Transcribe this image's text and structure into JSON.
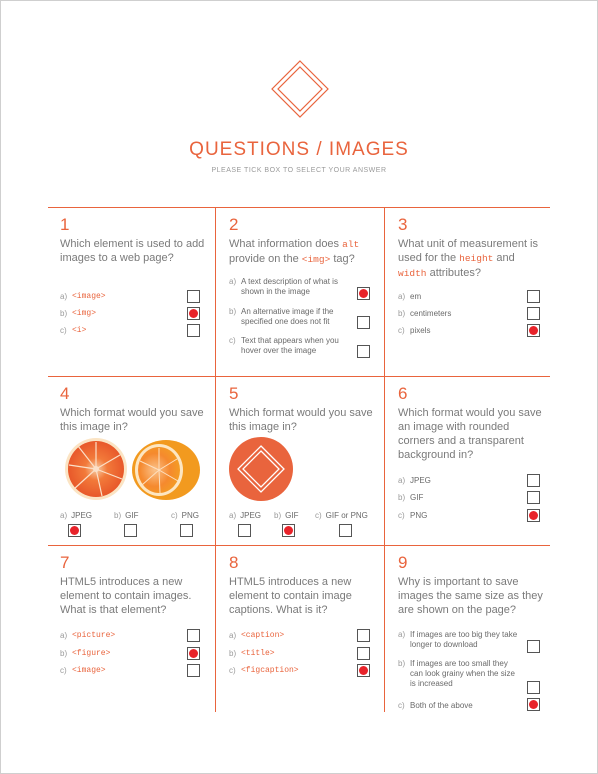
{
  "header": {
    "title": "QUESTIONS / IMAGES",
    "subtitle": "PLEASE TICK BOX TO SELECT YOUR ANSWER"
  },
  "colors": {
    "accent": "#e9643d",
    "check": "#e8232a"
  },
  "q1": {
    "num": "1",
    "text": "Which element is used to add images to a web page?",
    "options": [
      {
        "label": "a)",
        "text": "<image>",
        "checked": false
      },
      {
        "label": "b)",
        "text": "<img>",
        "checked": true
      },
      {
        "label": "c)",
        "text": "<i>",
        "checked": false
      }
    ]
  },
  "q2": {
    "num": "2",
    "text_a": "What information does ",
    "code_a": "alt",
    "text_b": " provide on the ",
    "code_b": "<img>",
    "text_c": " tag?",
    "options": [
      {
        "label": "a)",
        "text": "A text description of what is shown in the image",
        "checked": true
      },
      {
        "label": "b)",
        "text": "An alternative image if the specified one does not fit",
        "checked": false
      },
      {
        "label": "c)",
        "text": "Text that appears when you hover over the image",
        "checked": false
      }
    ]
  },
  "q3": {
    "num": "3",
    "text_a": "What unit of measurement is used for the ",
    "code_a": "height",
    "text_b": " and ",
    "code_b": "width",
    "text_c": " attributes?",
    "options": [
      {
        "label": "a)",
        "text": "em",
        "checked": false
      },
      {
        "label": "b)",
        "text": "centimeters",
        "checked": false
      },
      {
        "label": "c)",
        "text": "pixels",
        "checked": true
      }
    ]
  },
  "q4": {
    "num": "4",
    "text": "Which format would you save this image in?",
    "image": "grapefruit-photo",
    "options": [
      {
        "label": "a)",
        "text": "JPEG",
        "checked": true
      },
      {
        "label": "b)",
        "text": "GIF",
        "checked": false
      },
      {
        "label": "c)",
        "text": "PNG",
        "checked": false
      }
    ]
  },
  "q5": {
    "num": "5",
    "text": "Which format would you save this image in?",
    "image": "orange-circle-logo",
    "options": [
      {
        "label": "a)",
        "text": "JPEG",
        "checked": false
      },
      {
        "label": "b)",
        "text": "GIF",
        "checked": true
      },
      {
        "label": "c)",
        "text": "GIF or PNG",
        "checked": false
      }
    ]
  },
  "q6": {
    "num": "6",
    "text": "Which format would you save an image with rounded corners and a transparent background in?",
    "options": [
      {
        "label": "a)",
        "text": "JPEG",
        "checked": false
      },
      {
        "label": "b)",
        "text": "GIF",
        "checked": false
      },
      {
        "label": "c)",
        "text": "PNG",
        "checked": true
      }
    ]
  },
  "q7": {
    "num": "7",
    "text": "HTML5 introduces a new element to contain images. What is that element?",
    "options": [
      {
        "label": "a)",
        "text": "<picture>",
        "checked": false
      },
      {
        "label": "b)",
        "text": "<figure>",
        "checked": true
      },
      {
        "label": "c)",
        "text": "<image>",
        "checked": false
      }
    ]
  },
  "q8": {
    "num": "8",
    "text": "HTML5 introduces a new element to contain image captions. What is it?",
    "options": [
      {
        "label": "a)",
        "text": "<caption>",
        "checked": false
      },
      {
        "label": "b)",
        "text": "<title>",
        "checked": false
      },
      {
        "label": "c)",
        "text": "<figcaption>",
        "checked": true
      }
    ]
  },
  "q9": {
    "num": "9",
    "text": "Why is important to save images the same size as they are shown on the page?",
    "options": [
      {
        "label": "a)",
        "text": "If images are too big they take longer to download",
        "checked": false
      },
      {
        "label": "b)",
        "text": "If images are too small they can look grainy when the size is increased",
        "checked": false
      },
      {
        "label": "c)",
        "text": "Both of the above",
        "checked": true
      }
    ]
  }
}
